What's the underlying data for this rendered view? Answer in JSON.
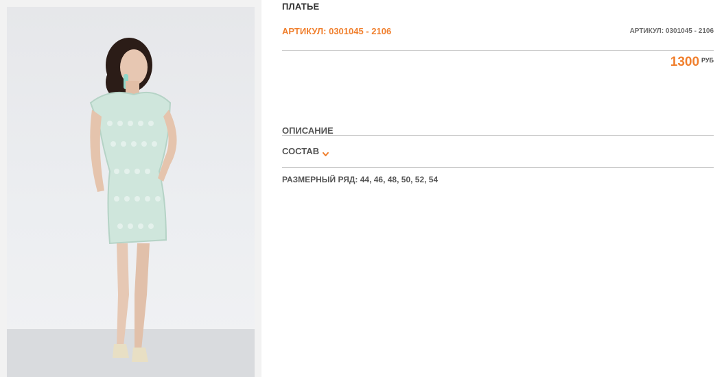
{
  "product": {
    "title": "ПЛАТЬЕ",
    "sku_main": "АРТИКУЛ: 0301045 - 2106",
    "sku_secondary": "АРТИКУЛ: 0301045 - 2106",
    "price_value": "1300",
    "price_currency": "РУБ",
    "description_label": "ОПИСАНИЕ",
    "composition_label": "СОСТАВ",
    "sizes_text": "РАЗМЕРНЫЙ РЯД: 44, 46, 48, 50, 52, 54"
  },
  "colors": {
    "accent": "#f07f2d",
    "dress": "#cfe6dc"
  },
  "icons": {
    "composition_toggle": "chevron-down-icon"
  }
}
